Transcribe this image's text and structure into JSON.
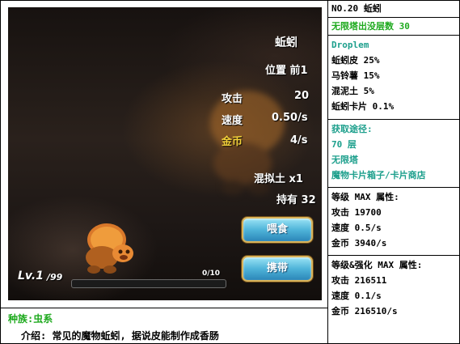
{
  "game": {
    "monster_name": "蚯蚓",
    "position": "位置 前1",
    "attack_label": "攻击",
    "attack_value": "20",
    "speed_label": "速度",
    "speed_value": "0.50/s",
    "gold_label": "金币",
    "gold_value": "4/s",
    "item_name": "混拟土 x1",
    "owned": "持有 32",
    "feed_button": "喂食",
    "carry_button": "携带",
    "level": "Lv.1",
    "level_max": "/99",
    "progress_text": "0/10",
    "progress_fraction": 0.0
  },
  "bottom": {
    "race": "种族:虫系",
    "intro": "介绍: 常见的魔物蚯蚓, 据说皮能制作成香肠"
  },
  "info": {
    "header": "NO.20 蚯蚓",
    "infinite_floor": "无限塔出没层数 30",
    "drop_title": "Droplem",
    "drops": [
      "蚯蚓皮 25%",
      "马铃薯 15%",
      "混泥土 5%",
      "蚯蚓卡片 0.1%"
    ],
    "obtain_title": "获取途径:",
    "obtain_floor": "70 层",
    "obtain_tower": "无限塔",
    "obtain_shop": "魔物卡片箱子/卡片商店",
    "max_title": "等级 MAX 属性:",
    "max_attack": "攻击 19700",
    "max_speed": "速度 0.5/s",
    "max_gold": "金币 3940/s",
    "enh_title": "等级&强化 MAX 属性:",
    "enh_attack": "攻击 216511",
    "enh_speed": "速度 0.1/s",
    "enh_gold": "金币 216510/s"
  },
  "colors": {
    "green_text": "#1faa1f",
    "teal_text": "#1c9f8c",
    "gold_text": "#f4d23a",
    "button_blue": "#4fb4d9"
  },
  "icons": [
    "worm-sprite-icon",
    "background-worm-icon"
  ]
}
